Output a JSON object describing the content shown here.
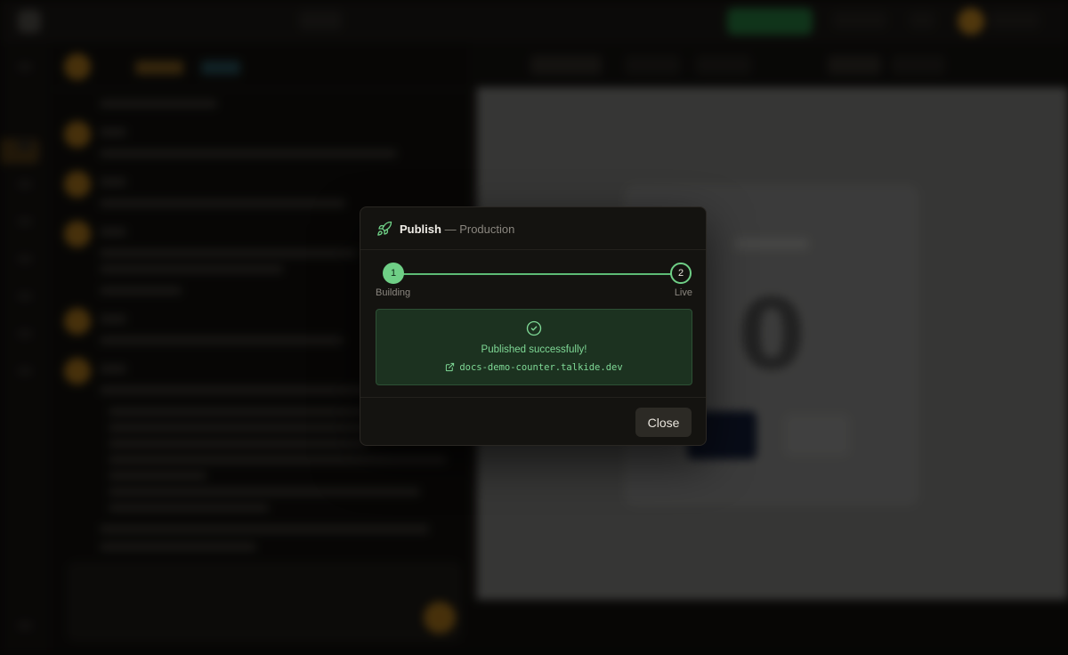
{
  "modal": {
    "title": "Publish",
    "title_separator": "—",
    "environment": "Production",
    "steps": [
      {
        "number": "1",
        "label": "Building",
        "status": "complete"
      },
      {
        "number": "2",
        "label": "Live",
        "status": "current"
      }
    ],
    "success_message": "Published successfully!",
    "published_url": "docs-demo-counter.talkide.dev",
    "close_label": "Close",
    "accent_color": "#6fcf86"
  },
  "background": {
    "counter_value": "0"
  },
  "icons": {
    "header": "rocket-icon",
    "success": "check-circle-icon",
    "link": "external-link-icon"
  }
}
